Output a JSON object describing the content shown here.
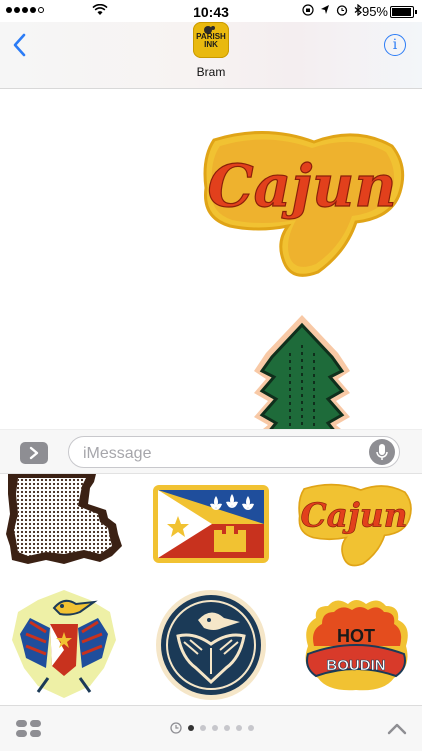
{
  "status_bar": {
    "time": "10:43",
    "battery": "95%",
    "icons": [
      "wifi-icon",
      "orientation-lock-icon",
      "location-icon",
      "alarm-icon",
      "bluetooth-icon",
      "battery-icon"
    ]
  },
  "header": {
    "back_icon": "chevron-left-icon",
    "contact_avatar_text": "PARISH INK",
    "contact_name": "Bram",
    "info_icon": "info-icon",
    "info_glyph": "i"
  },
  "transcript": {
    "stickers": [
      {
        "name": "cajun-sticker",
        "text": "Cajun"
      },
      {
        "name": "alligator-sticker",
        "text": ""
      }
    ]
  },
  "input_bar": {
    "apps_icon": "chevron-right-icon",
    "placeholder": "iMessage",
    "mic_icon": "microphone-icon"
  },
  "sticker_drawer": {
    "stickers": [
      {
        "name": "louisiana-state-sticker",
        "text": ""
      },
      {
        "name": "acadiana-flag-sticker",
        "text": ""
      },
      {
        "name": "cajun-sticker",
        "text": "Cajun"
      },
      {
        "name": "pelican-crest-sticker",
        "text": ""
      },
      {
        "name": "pelican-medallion-sticker",
        "text": ""
      },
      {
        "name": "hot-boudin-sticker",
        "text_top": "HOT",
        "text_main": "BOUDIN"
      }
    ]
  },
  "bottom_bar": {
    "app_drawer_icon": "app-grid-icon",
    "page_count": 6,
    "active_page": 1,
    "recent_icon": "clock-icon",
    "expand_icon": "chevron-up-icon"
  },
  "colors": {
    "accent": "#2b7cf6",
    "cajun_red": "#e2401c",
    "cajun_yellow": "#f1c232",
    "alligator_green": "#1e6b3a",
    "flag_blue": "#1f4e9c",
    "flag_red": "#c8321e",
    "pelican_navy": "#1b3a57",
    "brown": "#3b2114"
  }
}
